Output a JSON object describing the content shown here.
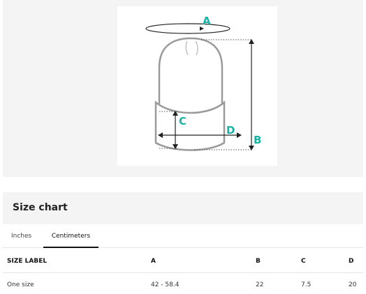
{
  "diagram": {
    "label_a": "A",
    "label_b": "B",
    "label_c": "C",
    "label_d": "D",
    "accent_color": "#19b3a6",
    "icon": "beanie-hat-icon"
  },
  "size_chart": {
    "title": "Size chart",
    "tabs": [
      {
        "label": "Inches",
        "active": false
      },
      {
        "label": "Centimeters",
        "active": true
      }
    ],
    "columns": [
      "SIZE LABEL",
      "A",
      "B",
      "C",
      "D"
    ],
    "rows": [
      [
        "One size",
        "42 - 58.4",
        "22",
        "7.5",
        "20"
      ]
    ]
  }
}
